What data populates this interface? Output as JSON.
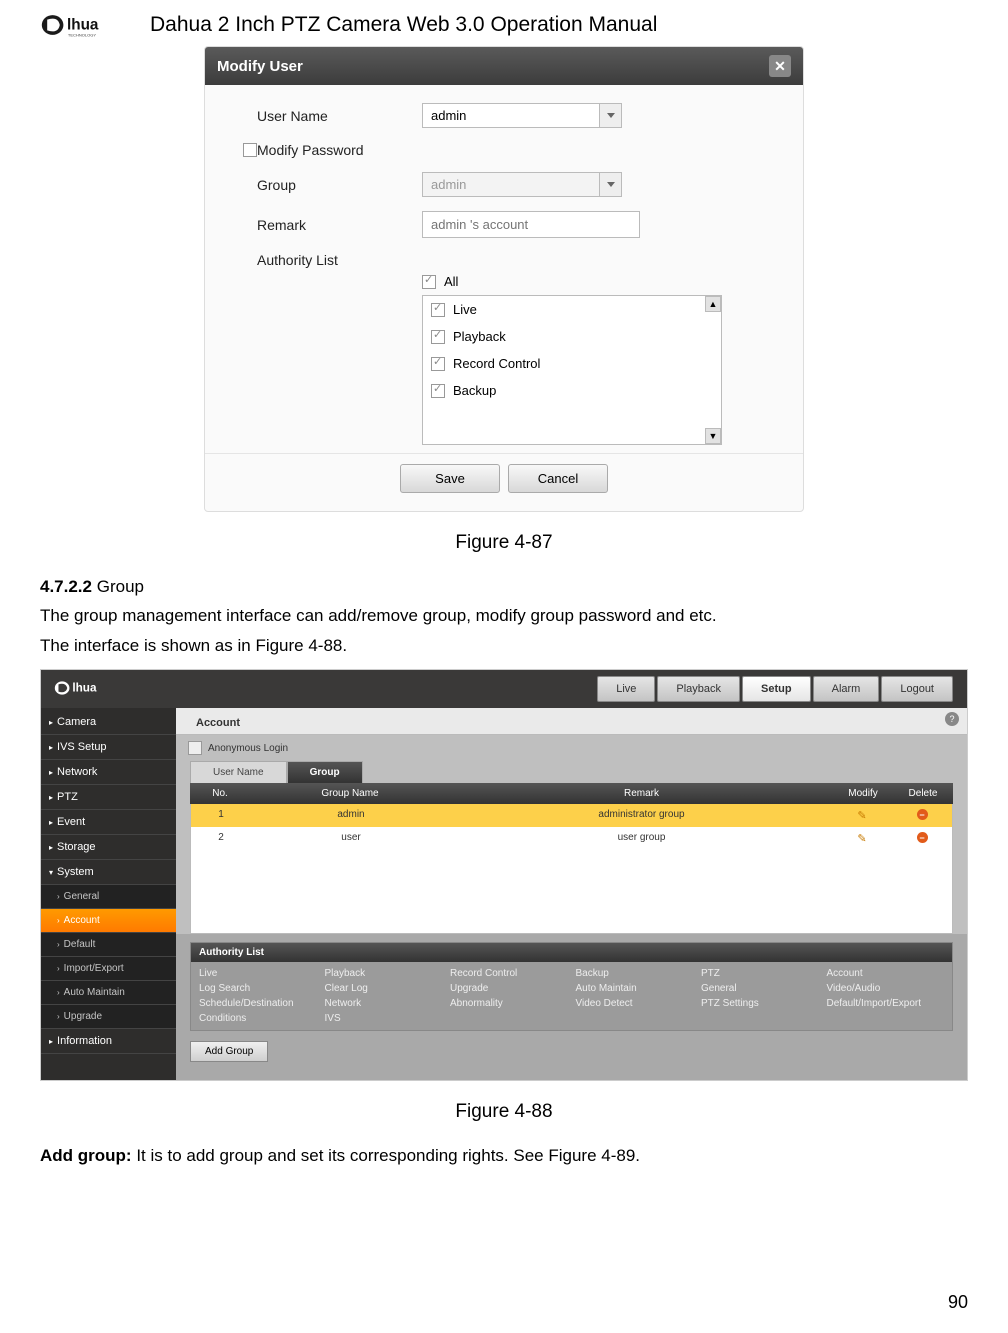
{
  "header": {
    "title": "Dahua 2 Inch PTZ Camera Web 3.0 Operation Manual"
  },
  "page_number": "90",
  "dialog": {
    "title": "Modify User",
    "labels": {
      "user_name": "User Name",
      "modify_password": "Modify Password",
      "group": "Group",
      "remark": "Remark",
      "authority_list": "Authority List"
    },
    "values": {
      "user_name": "admin",
      "group": "admin",
      "remark_placeholder": "admin 's account"
    },
    "auth_all": "All",
    "auth_items": [
      "Live",
      "Playback",
      "Record Control",
      "Backup"
    ],
    "buttons": {
      "save": "Save",
      "cancel": "Cancel"
    }
  },
  "fig87": "Figure 4-87",
  "section": {
    "num": "4.7.2.2",
    "title": "Group",
    "line1": "The group management interface can add/remove group, modify group password and etc.",
    "line2": "The interface is shown as in Figure 4-88."
  },
  "web": {
    "top_tabs": [
      "Live",
      "Playback",
      "Setup",
      "Alarm",
      "Logout"
    ],
    "active_top": "Setup",
    "sidebar_main": [
      "Camera",
      "IVS Setup",
      "Network",
      "PTZ",
      "Event",
      "Storage",
      "System",
      "Information"
    ],
    "sidebar_sub": [
      "General",
      "Account",
      "Default",
      "Import/Export",
      "Auto Maintain",
      "Upgrade"
    ],
    "active_sub": "Account",
    "content_title": "Account",
    "anonymous_label": "Anonymous Login",
    "sub_tabs": {
      "user": "User Name",
      "group": "Group"
    },
    "grid_head": {
      "no": "No.",
      "name": "Group Name",
      "remark": "Remark",
      "modify": "Modify",
      "delete": "Delete"
    },
    "rows": [
      {
        "no": "1",
        "name": "admin",
        "remark": "administrator group"
      },
      {
        "no": "2",
        "name": "user",
        "remark": "user group"
      }
    ],
    "authority_title": "Authority List",
    "authority_items": [
      "Live",
      "Playback",
      "Record Control",
      "Backup",
      "PTZ",
      "Account",
      "Log Search",
      "Clear Log",
      "Upgrade",
      "Auto Maintain",
      "General",
      "Video/Audio",
      "Schedule/Destination",
      "Network",
      "Abnormality",
      "Video Detect",
      "PTZ Settings",
      "Default/Import/Export",
      "Conditions",
      "IVS"
    ],
    "add_group_btn": "Add Group"
  },
  "fig88": "Figure 4-88",
  "footer_line": {
    "bold": "Add group:",
    "rest": " It is to add group and set its corresponding rights. See Figure 4-89."
  }
}
